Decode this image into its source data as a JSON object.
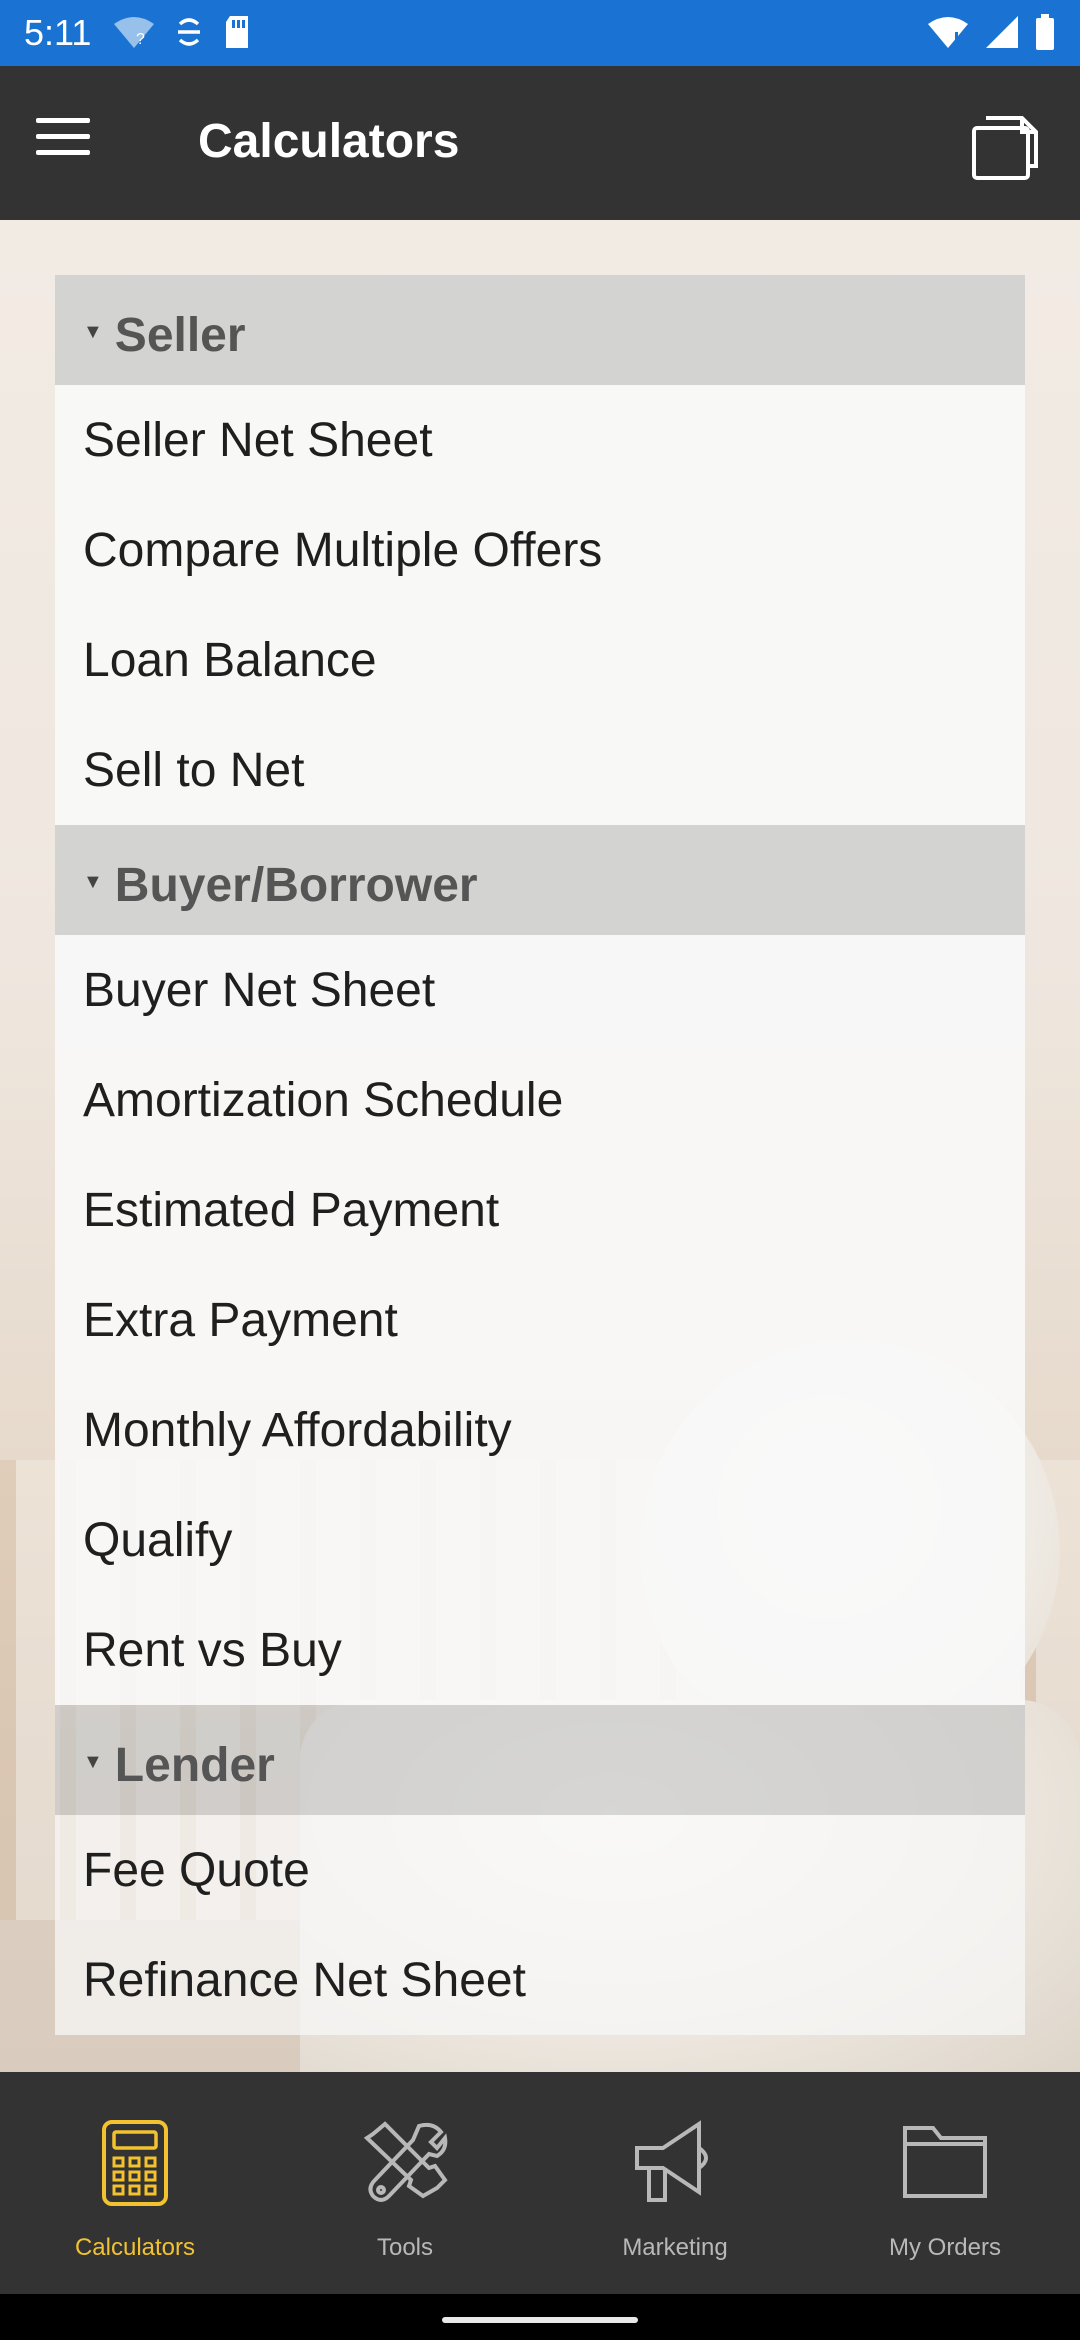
{
  "status_bar": {
    "time": "5:11",
    "left_icons": [
      "wifi-question-icon",
      "sync-icon",
      "sd-card-icon"
    ],
    "right_icons": [
      "wifi-icon",
      "signal-icon",
      "battery-icon"
    ]
  },
  "app_bar": {
    "title": "Calculators",
    "menu_icon": "hamburger-menu-icon",
    "action_icon": "copy-icon"
  },
  "sections": [
    {
      "title": "Seller",
      "items": [
        "Seller Net Sheet",
        "Compare Multiple Offers",
        "Loan Balance",
        "Sell to Net"
      ]
    },
    {
      "title": "Buyer/Borrower",
      "items": [
        "Buyer Net Sheet",
        "Amortization Schedule",
        "Estimated Payment",
        "Extra Payment",
        "Monthly Affordability",
        "Qualify",
        "Rent vs Buy"
      ]
    },
    {
      "title": "Lender",
      "items": [
        "Fee Quote",
        "Refinance Net Sheet"
      ]
    }
  ],
  "bottom_nav": {
    "items": [
      {
        "label": "Calculators",
        "icon": "calculator-icon",
        "active": true
      },
      {
        "label": "Tools",
        "icon": "tools-icon",
        "active": false
      },
      {
        "label": "Marketing",
        "icon": "megaphone-icon",
        "active": false
      },
      {
        "label": "My Orders",
        "icon": "folder-icon",
        "active": false
      }
    ]
  },
  "colors": {
    "status_bar": "#1a73d2",
    "app_bar": "#333333",
    "accent": "#f2c230",
    "inactive_nav": "#b8b8b8"
  }
}
